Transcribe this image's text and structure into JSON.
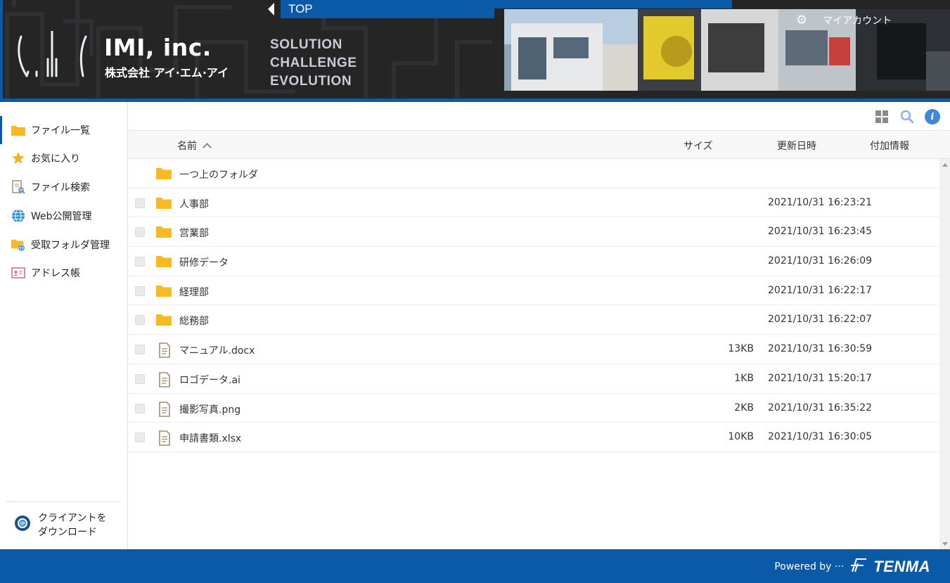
{
  "header": {
    "company_name": "IMI, inc.",
    "company_name_jp": "株式会社 アイ·エム·アイ",
    "taglines": [
      "SOLUTION",
      "CHALLENGE",
      "EVOLUTION"
    ],
    "top_label": "TOP",
    "account_label": "マイアカウント",
    "brand_color": "#0a5aa8"
  },
  "sidebar": {
    "items": [
      {
        "label": "ファイル一覧",
        "icon": "folder-icon",
        "active": true
      },
      {
        "label": "お気に入り",
        "icon": "star-icon"
      },
      {
        "label": "ファイル検索",
        "icon": "file-search-icon"
      },
      {
        "label": "Web公開管理",
        "icon": "globe-icon"
      },
      {
        "label": "受取フォルダ管理",
        "icon": "folder-globe-icon"
      },
      {
        "label": "アドレス帳",
        "icon": "address-card-icon"
      }
    ],
    "download_line1": "クライアントを",
    "download_line2": "ダウンロード"
  },
  "table": {
    "headers": {
      "name": "名前",
      "size": "サイズ",
      "date": "更新日時",
      "info": "付加情報"
    },
    "rows": [
      {
        "type": "folder",
        "name": "一つ上のフォルダ",
        "size": "",
        "date": "",
        "checkbox": false
      },
      {
        "type": "folder",
        "name": "人事部",
        "size": "",
        "date": "2021/10/31 16:23:21",
        "checkbox": true
      },
      {
        "type": "folder",
        "name": "営業部",
        "size": "",
        "date": "2021/10/31 16:23:45",
        "checkbox": true
      },
      {
        "type": "folder",
        "name": "研修データ",
        "size": "",
        "date": "2021/10/31 16:26:09",
        "checkbox": true
      },
      {
        "type": "folder",
        "name": "経理部",
        "size": "",
        "date": "2021/10/31 16:22:17",
        "checkbox": true
      },
      {
        "type": "folder",
        "name": "総務部",
        "size": "",
        "date": "2021/10/31 16:22:07",
        "checkbox": true
      },
      {
        "type": "file",
        "name": "マニュアル.docx",
        "size": "13KB",
        "date": "2021/10/31 16:30:59",
        "checkbox": true
      },
      {
        "type": "file",
        "name": "ロゴデータ.ai",
        "size": "1KB",
        "date": "2021/10/31 15:20:17",
        "checkbox": true
      },
      {
        "type": "file",
        "name": "撮影写真.png",
        "size": "2KB",
        "date": "2021/10/31 16:35:22",
        "checkbox": true
      },
      {
        "type": "file",
        "name": "申請書類.xlsx",
        "size": "10KB",
        "date": "2021/10/31 16:30:05",
        "checkbox": true
      }
    ]
  },
  "footer": {
    "powered_by": "Powered by ···",
    "brand": "TENMA"
  },
  "colors": {
    "folder": "#f7b924",
    "file": "#a08e73",
    "info": "#3f88d9"
  }
}
